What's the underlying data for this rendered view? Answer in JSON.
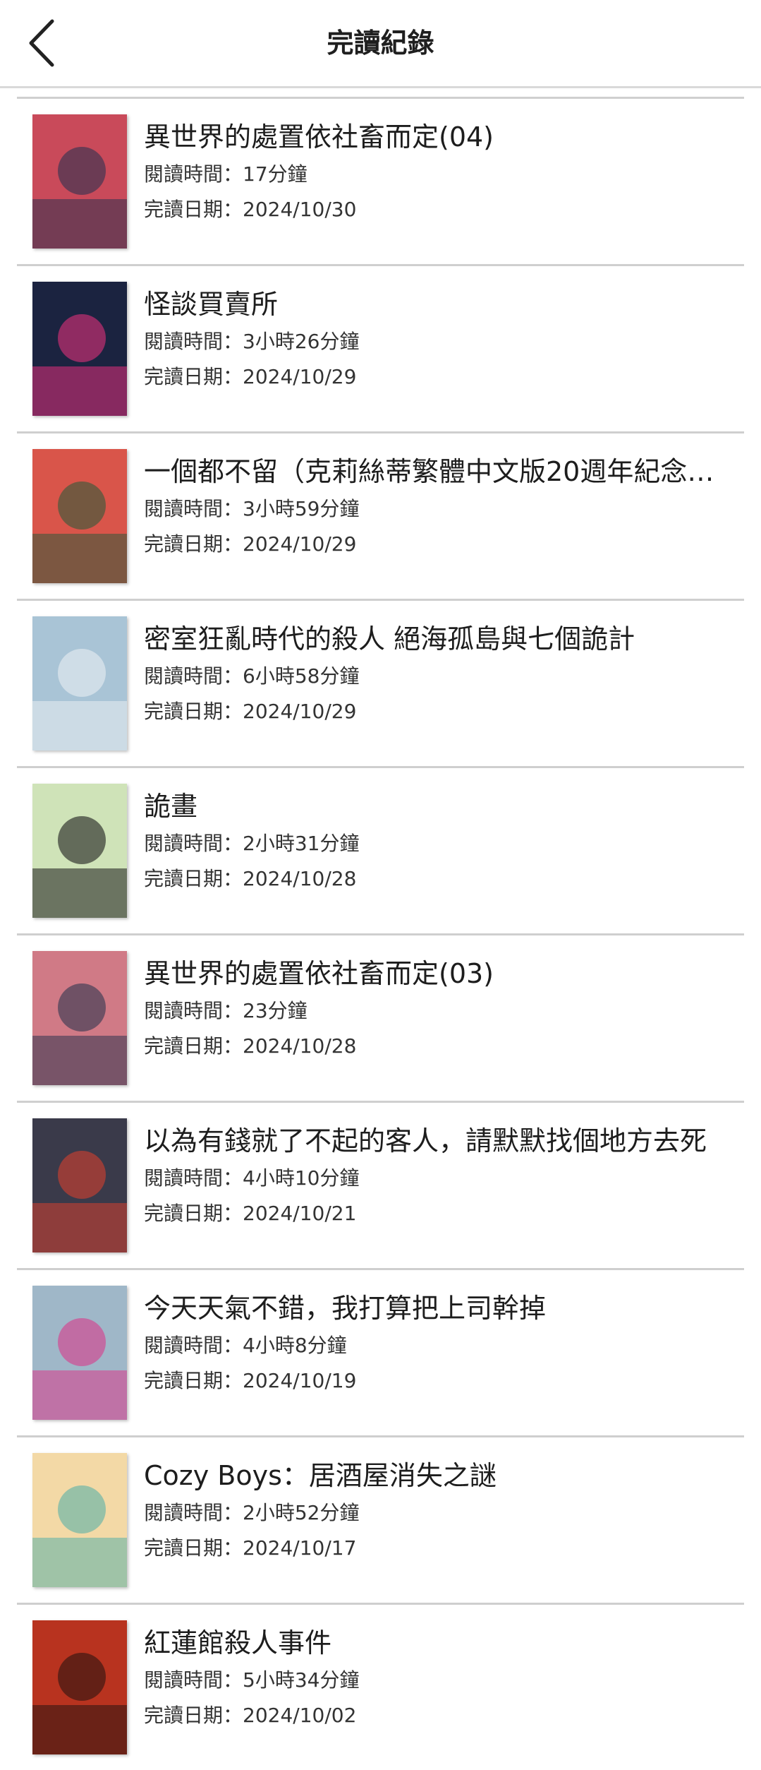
{
  "header": {
    "title": "完讀紀錄",
    "back_icon": "chevron-left-icon"
  },
  "labels": {
    "read_time": "閱讀時間：",
    "finish_date": "完讀日期："
  },
  "books": [
    {
      "title": "異世界的處置依社畜而定(04)",
      "read_time": "17分鐘",
      "finish_date": "2024/10/30",
      "cover_color": "#c94a5a",
      "cover_accent": "#2d3250"
    },
    {
      "title": "怪談買賣所",
      "read_time": "3小時26分鐘",
      "finish_date": "2024/10/29",
      "cover_color": "#1b2340",
      "cover_accent": "#e0307a"
    },
    {
      "title": "一個都不留（克莉絲蒂繁體中文版20週年紀念…",
      "read_time": "3小時59分鐘",
      "finish_date": "2024/10/29",
      "cover_color": "#d9554a",
      "cover_accent": "#2f5a3a"
    },
    {
      "title": "密室狂亂時代的殺人 絕海孤島與七個詭計",
      "read_time": "6小時58分鐘",
      "finish_date": "2024/10/29",
      "cover_color": "#a9c4d6",
      "cover_accent": "#e9eef2"
    },
    {
      "title": "詭畫",
      "read_time": "2小時31分鐘",
      "finish_date": "2024/10/28",
      "cover_color": "#cfe3b8",
      "cover_accent": "#1a1a1a"
    },
    {
      "title": "異世界的處置依社畜而定(03)",
      "read_time": "23分鐘",
      "finish_date": "2024/10/28",
      "cover_color": "#d07a86",
      "cover_accent": "#2f3550"
    },
    {
      "title": "以為有錢就了不起的客人，請默默找個地方去死",
      "read_time": "4小時10分鐘",
      "finish_date": "2024/10/21",
      "cover_color": "#3a3a4a",
      "cover_accent": "#d4402f"
    },
    {
      "title": "今天天氣不錯，我打算把上司幹掉",
      "read_time": "4小時8分鐘",
      "finish_date": "2024/10/19",
      "cover_color": "#9fb7c8",
      "cover_accent": "#d83a8a"
    },
    {
      "title": "Cozy Boys：居酒屋消失之謎",
      "read_time": "2小時52分鐘",
      "finish_date": "2024/10/17",
      "cover_color": "#f3d9a6",
      "cover_accent": "#5ab0a8"
    },
    {
      "title": "紅蓮館殺人事件",
      "read_time": "5小時34分鐘",
      "finish_date": "2024/10/02",
      "cover_color": "#b8331f",
      "cover_accent": "#2a1410"
    }
  ]
}
